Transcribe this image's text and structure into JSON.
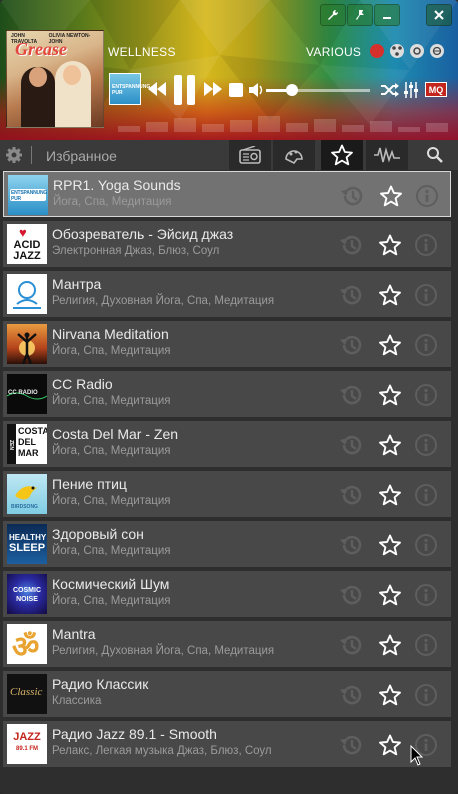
{
  "player": {
    "genre": "WELLNESS",
    "artist": "VARIOUS",
    "album_cover": {
      "title": "Grease",
      "names": [
        "JOHN TRAVOLTA",
        "OLIVIA NEWTON-JOHN"
      ]
    },
    "thumb_text": "ENTSPANNUNG PUR",
    "volume": 0.25,
    "quality_badge": "MQ",
    "window_buttons": [
      "wrench-icon",
      "pin-icon",
      "minimize-icon",
      "close-icon"
    ],
    "share_icons": [
      "record-icon",
      "network-icon",
      "chrome-icon",
      "globe-icon"
    ]
  },
  "toolbar": {
    "title": "Избранное",
    "tabs": [
      "radio-icon",
      "genre-icon",
      "favorites-star-icon",
      "waveform-icon",
      "search-icon"
    ],
    "active_tab": "favorites-star-icon"
  },
  "stations": [
    {
      "title": "RPR1. Yoga Sounds",
      "tags": "Йога, Спа, Медитация",
      "logo": "entspannung",
      "selected": true
    },
    {
      "title": "Обозреватель - Эйсид джаз",
      "tags": "Электронная Джаз, Блюз, Соул",
      "logo": "acidjazz"
    },
    {
      "title": "Мантра",
      "tags": "Религия, Духовная Йога, Спа, Медитация",
      "logo": "mantra-om"
    },
    {
      "title": "Nirvana Meditation",
      "tags": "Йога, Спа, Медитация",
      "logo": "nirvana"
    },
    {
      "title": "CC Radio",
      "tags": "Йога, Спа, Медитация",
      "logo": "ccradio"
    },
    {
      "title": "Costa Del Mar - Zen",
      "tags": "Йога, Спа, Медитация",
      "logo": "costadelmar"
    },
    {
      "title": "Пение птиц",
      "tags": "Йога, Спа, Медитация",
      "logo": "birdsong"
    },
    {
      "title": "Здоровый сон",
      "tags": "Йога, Спа, Медитация",
      "logo": "healthysleep"
    },
    {
      "title": "Космический Шум",
      "tags": "Йога, Спа, Медитация",
      "logo": "cosmicnoise"
    },
    {
      "title": "Mantra",
      "tags": "Религия, Духовная Йога, Спа, Медитация",
      "logo": "om"
    },
    {
      "title": "Радио Классик",
      "tags": "Классика",
      "logo": "classic"
    },
    {
      "title": "Радио Jazz 89.1 - Smooth",
      "tags": "Релакс, Легкая музыка Джаз, Блюз, Соул",
      "logo": "jazz891"
    }
  ],
  "logo_text": {
    "entspannung": "ENTSPANNUNG PUR",
    "acidjazz": [
      "ACID",
      "JAZZ"
    ],
    "costadelmar": [
      "COSTA",
      "DEL",
      "MAR",
      "ZEN"
    ],
    "birdsong": "BIRDSONG",
    "healthysleep": [
      "HEALTHY",
      "SLEEP"
    ],
    "cosmicnoise": [
      "COSMIC",
      "NOISE"
    ],
    "classic": "Classic",
    "jazz891": [
      "JAZZ",
      "89.1 FM"
    ],
    "ccradio": "CC RADIO"
  },
  "colors": {
    "accent_red": "#c3241b",
    "row_bg": "#484848",
    "row_selected": "#727272",
    "bg": "#2e2e2e"
  }
}
